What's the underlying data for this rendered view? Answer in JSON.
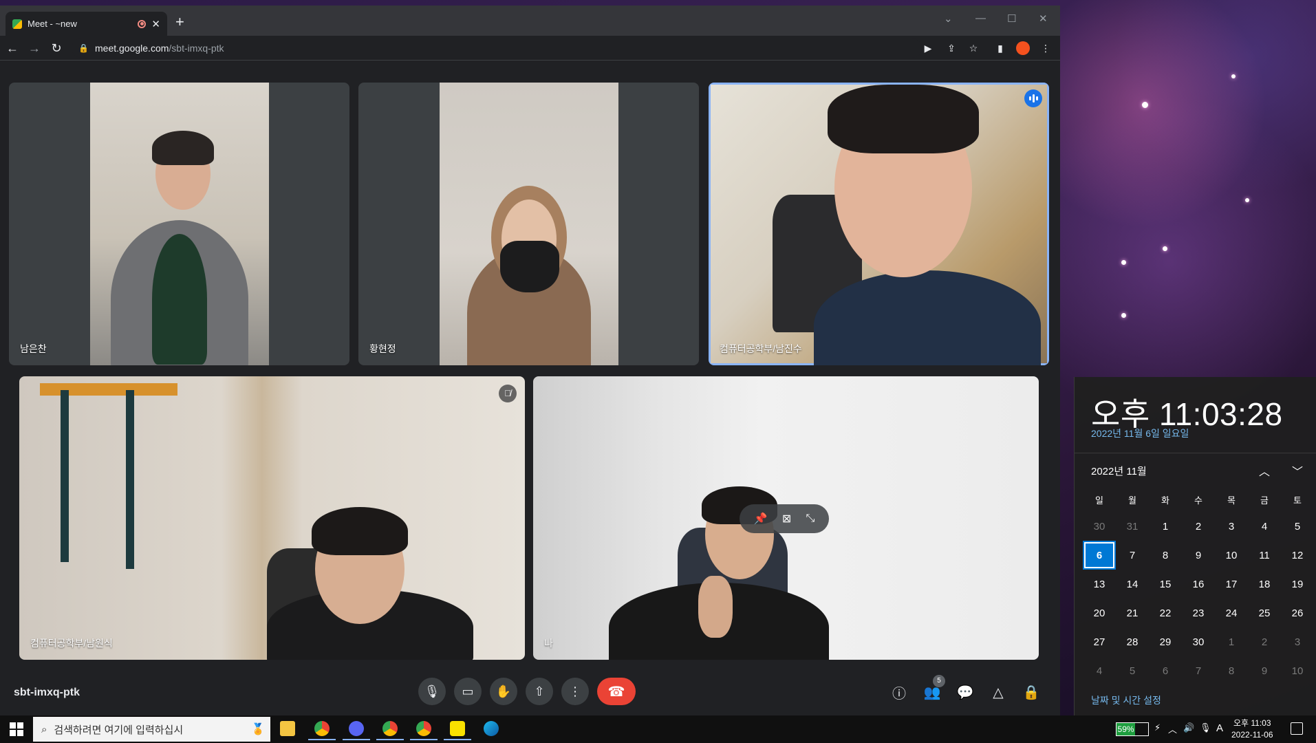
{
  "browser": {
    "tab_title": "Meet - ~new",
    "url_host": "meet.google.com",
    "url_path": "/sbt-imxq-ptk"
  },
  "meet": {
    "meeting_code": "sbt-imxq-ptk",
    "participant_count": "5",
    "participants": [
      {
        "name": "남은찬"
      },
      {
        "name": "황현정"
      },
      {
        "name": "컴퓨터공학부/남진수"
      },
      {
        "name": "컴퓨터공학부/남원식"
      },
      {
        "name": "나"
      }
    ]
  },
  "calendar": {
    "time": "오후 11:03:28",
    "date": "2022년 11월 6일 일요일",
    "month_label": "2022년 11월",
    "weekdays": [
      "일",
      "월",
      "화",
      "수",
      "목",
      "금",
      "토"
    ],
    "days": [
      [
        "30",
        "31",
        "1",
        "2",
        "3",
        "4",
        "5"
      ],
      [
        "6",
        "7",
        "8",
        "9",
        "10",
        "11",
        "12"
      ],
      [
        "13",
        "14",
        "15",
        "16",
        "17",
        "18",
        "19"
      ],
      [
        "20",
        "21",
        "22",
        "23",
        "24",
        "25",
        "26"
      ],
      [
        "27",
        "28",
        "29",
        "30",
        "1",
        "2",
        "3"
      ],
      [
        "4",
        "5",
        "6",
        "7",
        "8",
        "9",
        "10"
      ]
    ],
    "today": "6",
    "settings_link": "날짜 및 시간 설정"
  },
  "taskbar": {
    "search_placeholder": "검색하려면 여기에 입력하십시",
    "battery": "59%",
    "battery_level": 0.59,
    "ime": "A",
    "tray_time": "오후 11:03",
    "tray_date": "2022-11-06"
  },
  "colors": {
    "accent": "#8ab4f8",
    "hangup": "#ea4335",
    "today": "#0078d4"
  }
}
